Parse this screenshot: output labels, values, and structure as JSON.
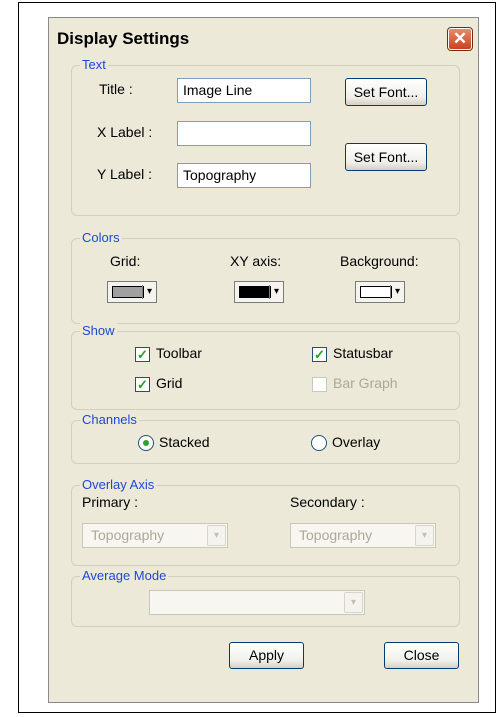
{
  "window": {
    "title": "Display Settings",
    "close_glyph": "✕"
  },
  "text_group": {
    "legend": "Text",
    "title_label": "Title :",
    "title_value": "Image Line",
    "xlabel_label": "X Label :",
    "xlabel_value": "",
    "ylabel_label": "Y Label :",
    "ylabel_value": "Topography",
    "set_font_1": "Set Font...",
    "set_font_2": "Set Font..."
  },
  "colors_group": {
    "legend": "Colors",
    "grid_label": "Grid:",
    "xy_label": "XY axis:",
    "bg_label": "Background:",
    "grid_color": "#a0a0a0",
    "xy_color": "#000000",
    "bg_color": "#ffffff"
  },
  "show_group": {
    "legend": "Show",
    "toolbar_label": "Toolbar",
    "statusbar_label": "Statusbar",
    "grid_label": "Grid",
    "bargraph_label": "Bar Graph",
    "check_glyph": "✓"
  },
  "channels_group": {
    "legend": "Channels",
    "stacked_label": "Stacked",
    "overlay_label": "Overlay"
  },
  "overlay_axis_group": {
    "legend": "Overlay Axis",
    "primary_label": "Primary :",
    "secondary_label": "Secondary :",
    "primary_value": "Topography",
    "secondary_value": "Topography"
  },
  "average_mode_group": {
    "legend": "Average Mode",
    "value": ""
  },
  "buttons": {
    "apply": "Apply",
    "close": "Close"
  },
  "dropdown_glyph": "▾"
}
